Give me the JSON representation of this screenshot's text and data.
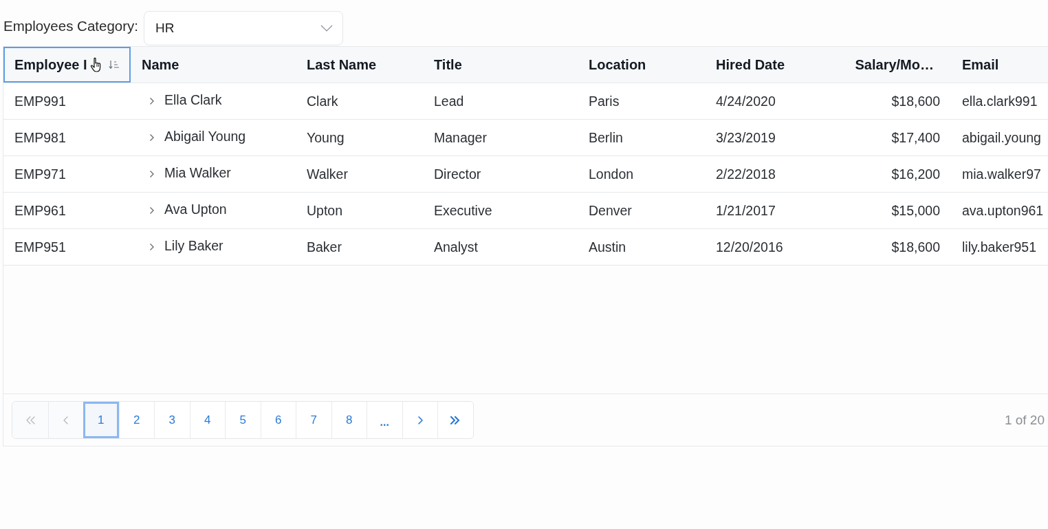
{
  "filter": {
    "label": "Employees Category:",
    "value": "HR"
  },
  "table": {
    "columns": [
      {
        "label": "Employee I",
        "kind": "text",
        "focused": true,
        "hovered": true
      },
      {
        "label": "Name",
        "kind": "name",
        "focused": false,
        "hovered": false
      },
      {
        "label": "Last Name",
        "kind": "text",
        "focused": false,
        "hovered": false
      },
      {
        "label": "Title",
        "kind": "text",
        "focused": false,
        "hovered": false
      },
      {
        "label": "Location",
        "kind": "text",
        "focused": false,
        "hovered": false
      },
      {
        "label": "Hired Date",
        "kind": "text",
        "focused": false,
        "hovered": false
      },
      {
        "label": "Salary/Mo…",
        "kind": "number",
        "focused": false,
        "hovered": false
      },
      {
        "label": "Email",
        "kind": "text",
        "focused": false,
        "hovered": false
      }
    ],
    "rows": [
      {
        "cells": [
          "EMP991",
          "Ella Clark",
          "Clark",
          "Lead",
          "Paris",
          "4/24/2020",
          "$18,600",
          "ella.clark991"
        ],
        "expanded": false
      },
      {
        "cells": [
          "EMP981",
          "Abigail Young",
          "Young",
          "Manager",
          "Berlin",
          "3/23/2019",
          "$17,400",
          "abigail.young"
        ],
        "expanded": false
      },
      {
        "cells": [
          "EMP971",
          "Mia Walker",
          "Walker",
          "Director",
          "London",
          "2/22/2018",
          "$16,200",
          "mia.walker97"
        ],
        "expanded": false
      },
      {
        "cells": [
          "EMP961",
          "Ava Upton",
          "Upton",
          "Executive",
          "Denver",
          "1/21/2017",
          "$15,000",
          "ava.upton961"
        ],
        "expanded": false
      },
      {
        "cells": [
          "EMP951",
          "Lily Baker",
          "Baker",
          "Analyst",
          "Austin",
          "12/20/2016",
          "$18,600",
          "lily.baker951"
        ],
        "expanded": false
      }
    ]
  },
  "pager": {
    "buttons": [
      {
        "kind": "first",
        "selected": false,
        "disabled": true
      },
      {
        "kind": "prev",
        "selected": false,
        "disabled": true
      },
      {
        "kind": "page",
        "label": "1",
        "selected": true,
        "disabled": false
      },
      {
        "kind": "page",
        "label": "2",
        "selected": false,
        "disabled": false
      },
      {
        "kind": "page",
        "label": "3",
        "selected": false,
        "disabled": false
      },
      {
        "kind": "page",
        "label": "4",
        "selected": false,
        "disabled": false
      },
      {
        "kind": "page",
        "label": "5",
        "selected": false,
        "disabled": false
      },
      {
        "kind": "page",
        "label": "6",
        "selected": false,
        "disabled": false
      },
      {
        "kind": "page",
        "label": "7",
        "selected": false,
        "disabled": false
      },
      {
        "kind": "page",
        "label": "8",
        "selected": false,
        "disabled": false
      },
      {
        "kind": "ellipsis",
        "label": "...",
        "selected": false,
        "disabled": false
      },
      {
        "kind": "next",
        "selected": false,
        "disabled": false
      },
      {
        "kind": "last",
        "selected": false,
        "disabled": false
      }
    ],
    "summary": "1 of 20"
  }
}
